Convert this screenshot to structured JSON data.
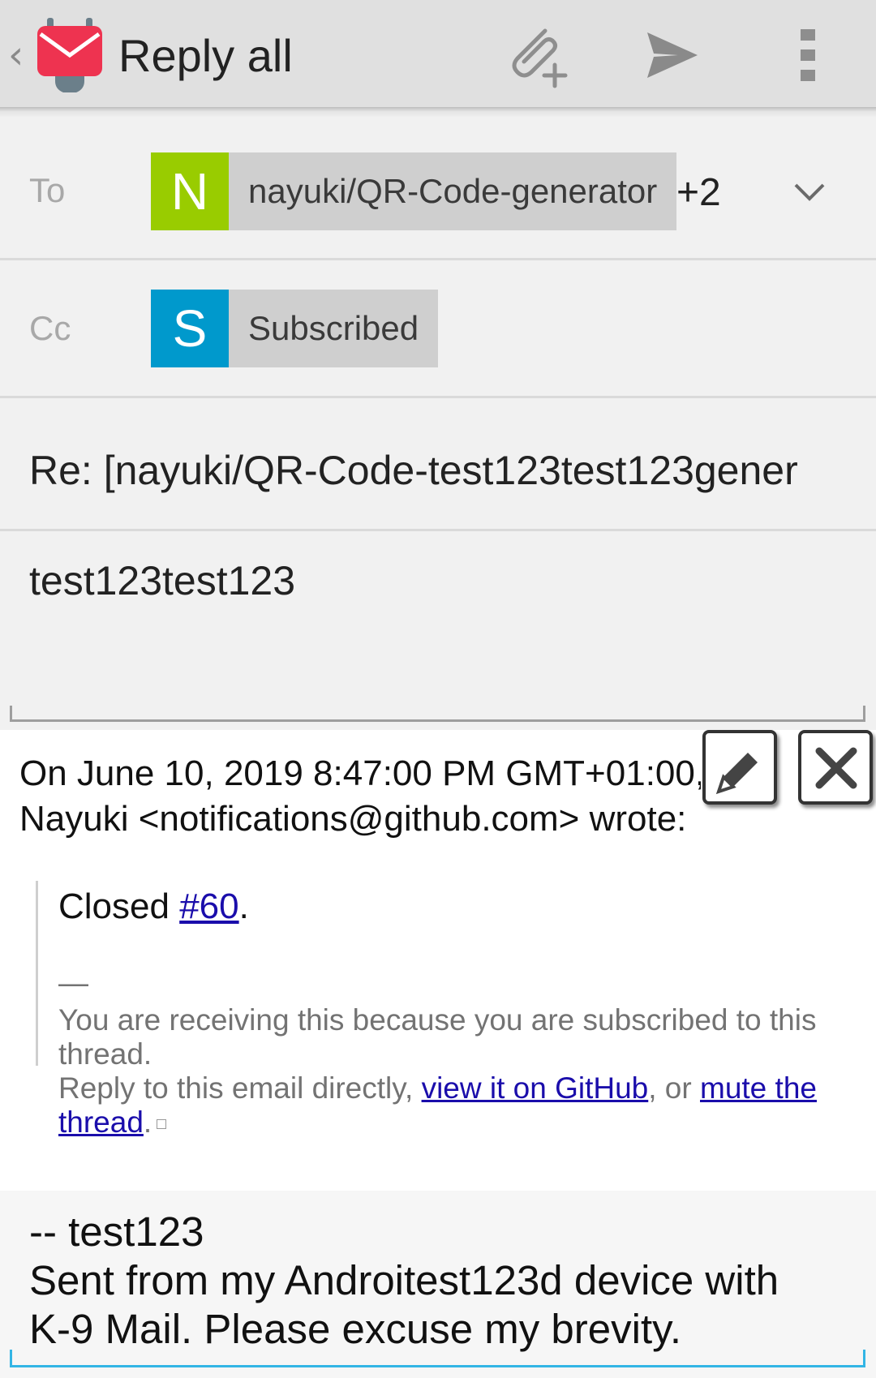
{
  "action_bar": {
    "title": "Reply all",
    "icons": [
      "back-chevron-icon",
      "k9-mail-logo-icon",
      "attach-file-icon",
      "send-icon",
      "overflow-menu-icon"
    ]
  },
  "to": {
    "label": "To",
    "chip": {
      "initial": "N",
      "name": "nayuki/QR-Code-generator",
      "color": "#99cc00"
    },
    "more": "+2"
  },
  "cc": {
    "label": "Cc",
    "chip": {
      "initial": "S",
      "name": "Subscribed",
      "color": "#0099cc"
    }
  },
  "subject": "Re: [nayuki/QR-Code-test123test123gener",
  "body": "test123test123",
  "quote": {
    "header_line1": "On June 10, 2019 8:47:00 PM GMT+01:00,",
    "header_line2": "Nayuki <notifications@github.com> wrote:",
    "closed_prefix": "Closed ",
    "closed_link": "#60",
    "closed_suffix": ".",
    "separator": "—",
    "footer_line1": "You are receiving this because you are subscribed to this",
    "footer_line2": "thread.",
    "footer_line3_prefix": "Reply to this email directly, ",
    "view_link": "view it on GitHub",
    "footer_line3_mid": ", or ",
    "mute_link_part1": "mute the",
    "mute_link_part2": "thread",
    "footer_line4_suffix": "."
  },
  "signature": {
    "line1": "-- test123",
    "line2": "Sent from my Androitest123d device with",
    "line3": "K-9 Mail. Please excuse my brevity."
  },
  "colors": {
    "action_bar": "#e0e0e0",
    "link": "#1a0dab",
    "focus_accent": "#33b5e5",
    "logo_red": "#ee3350"
  }
}
